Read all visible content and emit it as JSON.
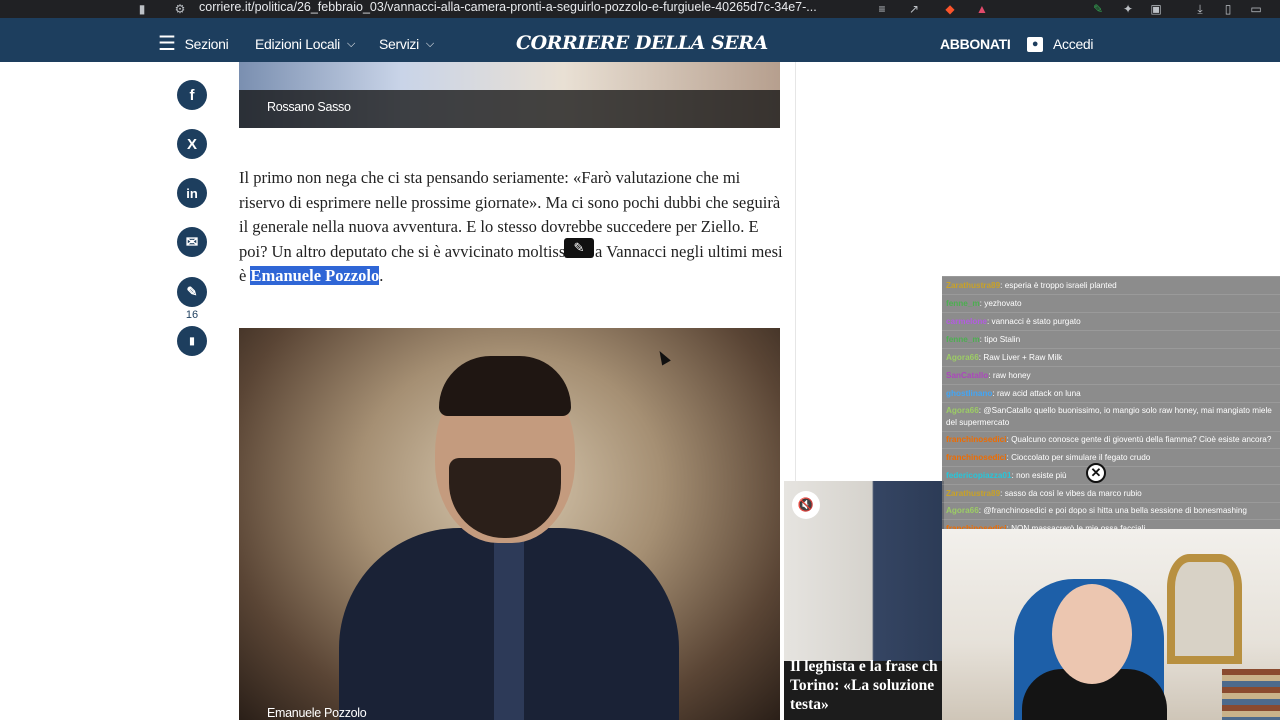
{
  "browser": {
    "url": "corriere.it/politica/26_febbraio_03/vannacci-alla-camera-pronti-a-seguirlo-pozzolo-e-furgiuele-40265d7c-34e7-..."
  },
  "nav": {
    "sections_label": "Sezioni",
    "local_editions_label": "Edizioni Locali",
    "services_label": "Servizi",
    "logo": "CORRIERE DELLA SERA",
    "subscribe_label": "ABBONATI",
    "login_label": "Accedi"
  },
  "article": {
    "photo1_caption": "Rossano Sasso",
    "paragraph_before": "Il primo non nega che ci sta pensando seriamente: «Farò valutazione che mi riservo di esprimere nelle prossime giornate». Ma ci sono pochi dubbi che seguirà il generale nella nuova avventura. E lo stesso dovrebbe succedere per Ziello. E poi? Un altro deputato che si è avvicinato moltissimo a Vannacci negli ultimi mesi è ",
    "highlight": "Emanuele Pozzolo",
    "paragraph_after": ".",
    "photo2_caption": "Emanuele Pozzolo",
    "comments_count": "16"
  },
  "icons": {
    "facebook": "f",
    "x": "X",
    "linkedin": "in",
    "mail": "✉",
    "comment": "✎",
    "bookmark": "▮",
    "mute": "🔇",
    "close": "✕"
  },
  "video": {
    "title_line1": "Il leghista e la frase ch",
    "title_line2": "Torino: «La soluzione",
    "title_line3": "testa»"
  },
  "chat": {
    "messages": [
      {
        "user": "Zarathustra89",
        "text": ": esperia è troppo israeli planted",
        "color": "#c9a227"
      },
      {
        "user": "fenne_m",
        "text": ": yezhovato",
        "color": "#4caf50"
      },
      {
        "user": "carmelone",
        "text": ": vannacci è stato purgato",
        "color": "#b25ce0"
      },
      {
        "user": "fenne_m",
        "text": ": tipo Stalin",
        "color": "#4caf50"
      },
      {
        "user": "Agora66",
        "text": ": Raw Liver + Raw Milk",
        "color": "#9ccc65"
      },
      {
        "user": "SanCatallo",
        "text": ": raw honey",
        "color": "#ab47bc"
      },
      {
        "user": "ghostlinano",
        "text": ": raw acid attack on luna",
        "color": "#42a5f5"
      },
      {
        "user": "Agora66",
        "text": ": @SanCatallo quello buonissimo, io mangio solo raw honey, mai mangiato miele del supermercato",
        "color": "#9ccc65"
      },
      {
        "user": "franchinosedici",
        "text": ": Qualcuno conosce gente di gioventù della fiamma? Cioè esiste ancora?",
        "color": "#ef6c00"
      },
      {
        "user": "franchinosedici",
        "text": ": Cioccolato per simulare il fegato crudo",
        "color": "#ef6c00"
      },
      {
        "user": "federicopiazza01",
        "text": ": non esiste più",
        "color": "#26c6da"
      },
      {
        "user": "Zarathustra89",
        "text": ": sasso da così le vibes da marco rubio",
        "color": "#c9a227"
      },
      {
        "user": "Agora66",
        "text": ": @franchinosedici e poi dopo si hitta una bella sessione di bonesmashing",
        "color": "#9ccc65"
      },
      {
        "user": "franchinosedici",
        "text": ": NON massacrerò le mie ossa facciali",
        "color": "#ef6c00"
      }
    ]
  },
  "colors": {
    "brand": "#1d3e5e",
    "highlight": "#2f66d6"
  }
}
